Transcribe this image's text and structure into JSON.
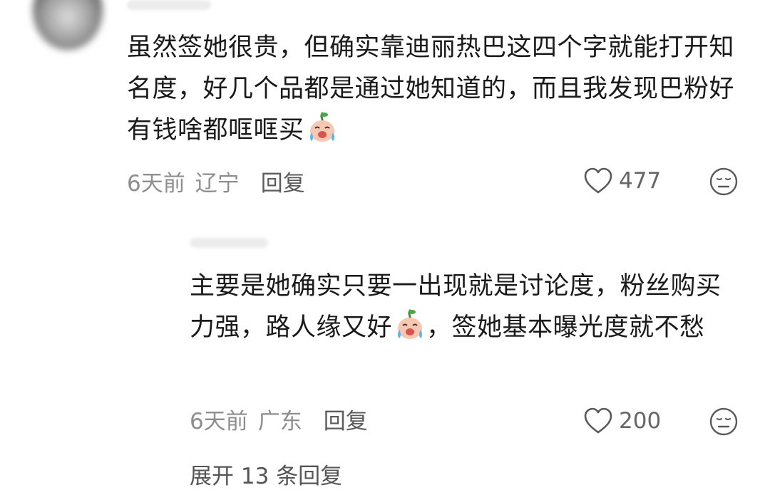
{
  "comment": {
    "text_before_emoji": "虽然签她很贵，但确实靠迪丽热巴这四个字就能打开知名度，好几个品都是通过她知道的，而且我发现巴粉好有钱啥都哐哐买",
    "text_after_emoji": "",
    "emoji": "crying-laughing-sticker",
    "time": "6天前",
    "location": "辽宁",
    "reply_label": "回复",
    "like_count": "477"
  },
  "reply": {
    "text_before_emoji": "主要是她确实只要一出现就是讨论度，粉丝购买力强，路人缘又好",
    "emoji": "crying-laughing-sticker",
    "text_after_emoji": "，签她基本曝光度就不愁",
    "time": "6天前",
    "location": "广东",
    "reply_label": "回复",
    "like_count": "200"
  },
  "expand_label": "展开 13 条回复",
  "icons": {
    "like": "heart-outline-icon",
    "dislike": "neutral-face-icon"
  },
  "colors": {
    "text": "#1a1a1a",
    "meta": "#8e8e8e",
    "icon": "#5a5a5a",
    "emoji_face": "#f7c7b2",
    "emoji_tear": "#56b8f0"
  }
}
